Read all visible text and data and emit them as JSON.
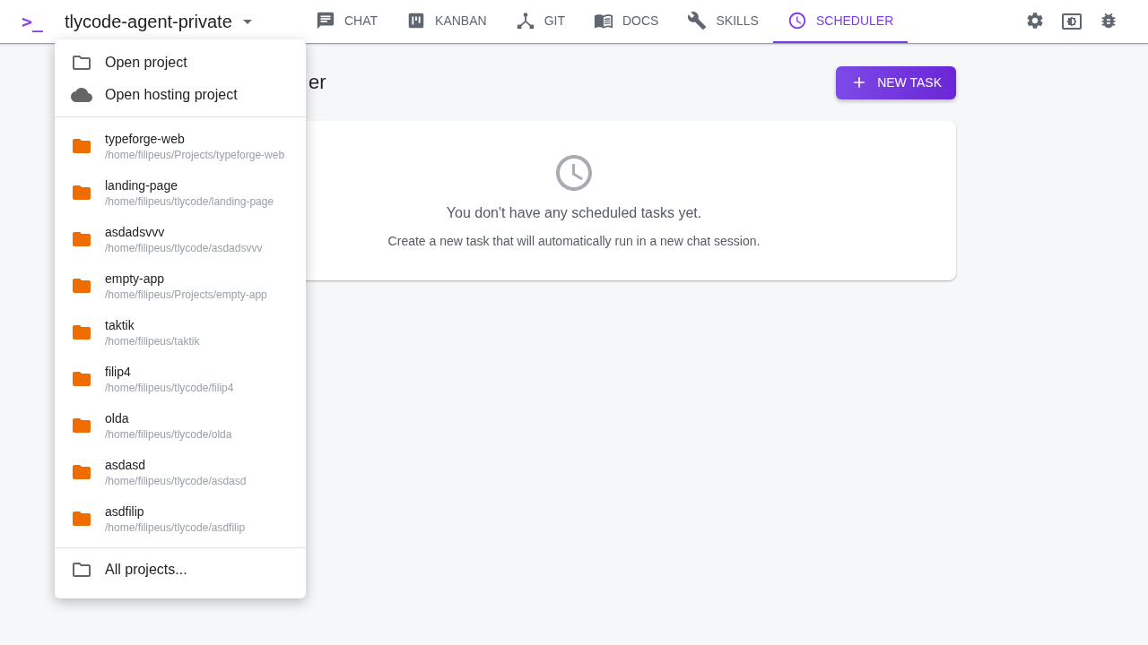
{
  "app_bar": {
    "logo": ">_",
    "project": "tlycode-agent-private",
    "tabs": [
      {
        "label": "CHAT",
        "selected": false
      },
      {
        "label": "KANBAN",
        "selected": false
      },
      {
        "label": "GIT",
        "selected": false
      },
      {
        "label": "DOCS",
        "selected": false
      },
      {
        "label": "SKILLS",
        "selected": false
      },
      {
        "label": "SCHEDULER",
        "selected": true
      }
    ]
  },
  "page": {
    "title": "er",
    "new_task_button": "NEW TASK",
    "empty_state": {
      "title": "You don't have any scheduled tasks yet.",
      "subtitle": "Create a new task that will automatically run in a new chat session."
    }
  },
  "project_menu": {
    "actions": [
      {
        "label": "Open project"
      },
      {
        "label": "Open hosting project"
      }
    ],
    "recent_projects": [
      {
        "name": "typeforge-web",
        "path": "/home/filipeus/Projects/typeforge-web"
      },
      {
        "name": "landing-page",
        "path": "/home/filipeus/tlycode/landing-page"
      },
      {
        "name": "asdadsvvv",
        "path": "/home/filipeus/tlycode/asdadsvvv"
      },
      {
        "name": "empty-app",
        "path": "/home/filipeus/Projects/empty-app"
      },
      {
        "name": "taktik",
        "path": "/home/filipeus/taktik"
      },
      {
        "name": "filip4",
        "path": "/home/filipeus/tlycode/filip4"
      },
      {
        "name": "olda",
        "path": "/home/filipeus/tlycode/olda"
      },
      {
        "name": "asdasd",
        "path": "/home/filipeus/tlycode/asdasd"
      },
      {
        "name": "asdfilip",
        "path": "/home/filipeus/tlycode/asdfilip"
      }
    ],
    "footer": "All projects..."
  }
}
